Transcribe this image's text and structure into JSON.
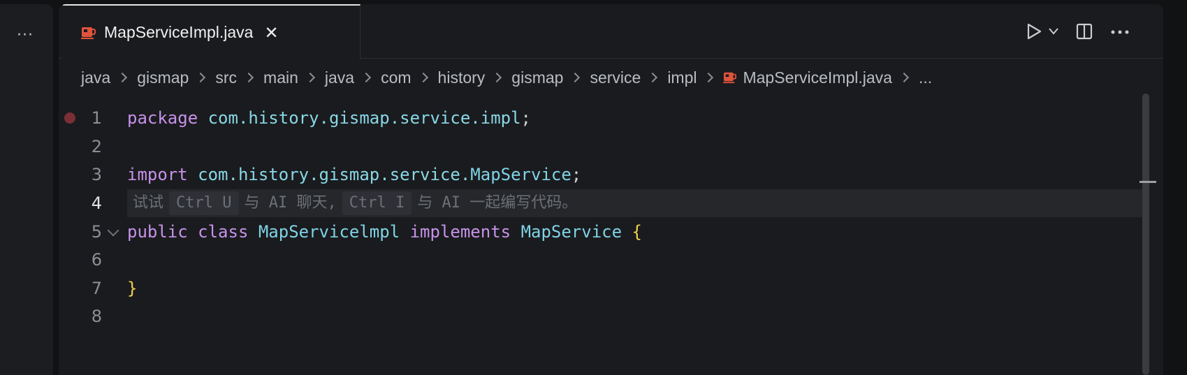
{
  "left_panel": {
    "more_glyph": "···"
  },
  "tab": {
    "label": "MapServiceImpl.java",
    "close_glyph": "✕",
    "icon": "java-file-icon"
  },
  "toolbar": {
    "icons": [
      "run-icon",
      "chevron-down-icon",
      "split-editor-icon",
      "more-icon"
    ],
    "more_glyph": "···"
  },
  "breadcrumb": {
    "items": [
      "java",
      "gismap",
      "src",
      "main",
      "java",
      "com",
      "history",
      "gismap",
      "service",
      "impl",
      "MapServiceImpl.java",
      "..."
    ]
  },
  "editor": {
    "line_numbers": [
      "1",
      "2",
      "3",
      "4",
      "5",
      "6",
      "7",
      "8"
    ],
    "line1": {
      "kw": "package",
      "pkg": "com.history.gismap.service.impl",
      "semi": ";"
    },
    "line3": {
      "kw": "import",
      "pkg": "com.history.gismap.service.",
      "type": "MapService",
      "semi": ";"
    },
    "hint": {
      "t1": "试试",
      "k1": "Ctrl U",
      "t2": "与 AI 聊天,",
      "k2": "Ctrl I",
      "t3": "与 AI 一起编写代码。"
    },
    "line5": {
      "kw1": "public",
      "kw2": "class",
      "cls": "MapServicelmpl",
      "kw3": "implements",
      "iface": "MapService",
      "brace": "{"
    },
    "line7": {
      "brace": "}"
    }
  },
  "colors": {
    "keyword": "#c792ea",
    "package": "#89d8e6",
    "brace": "#f0d24a",
    "breakpoint": "#7a2f37",
    "java_icon": "#e0533d"
  }
}
